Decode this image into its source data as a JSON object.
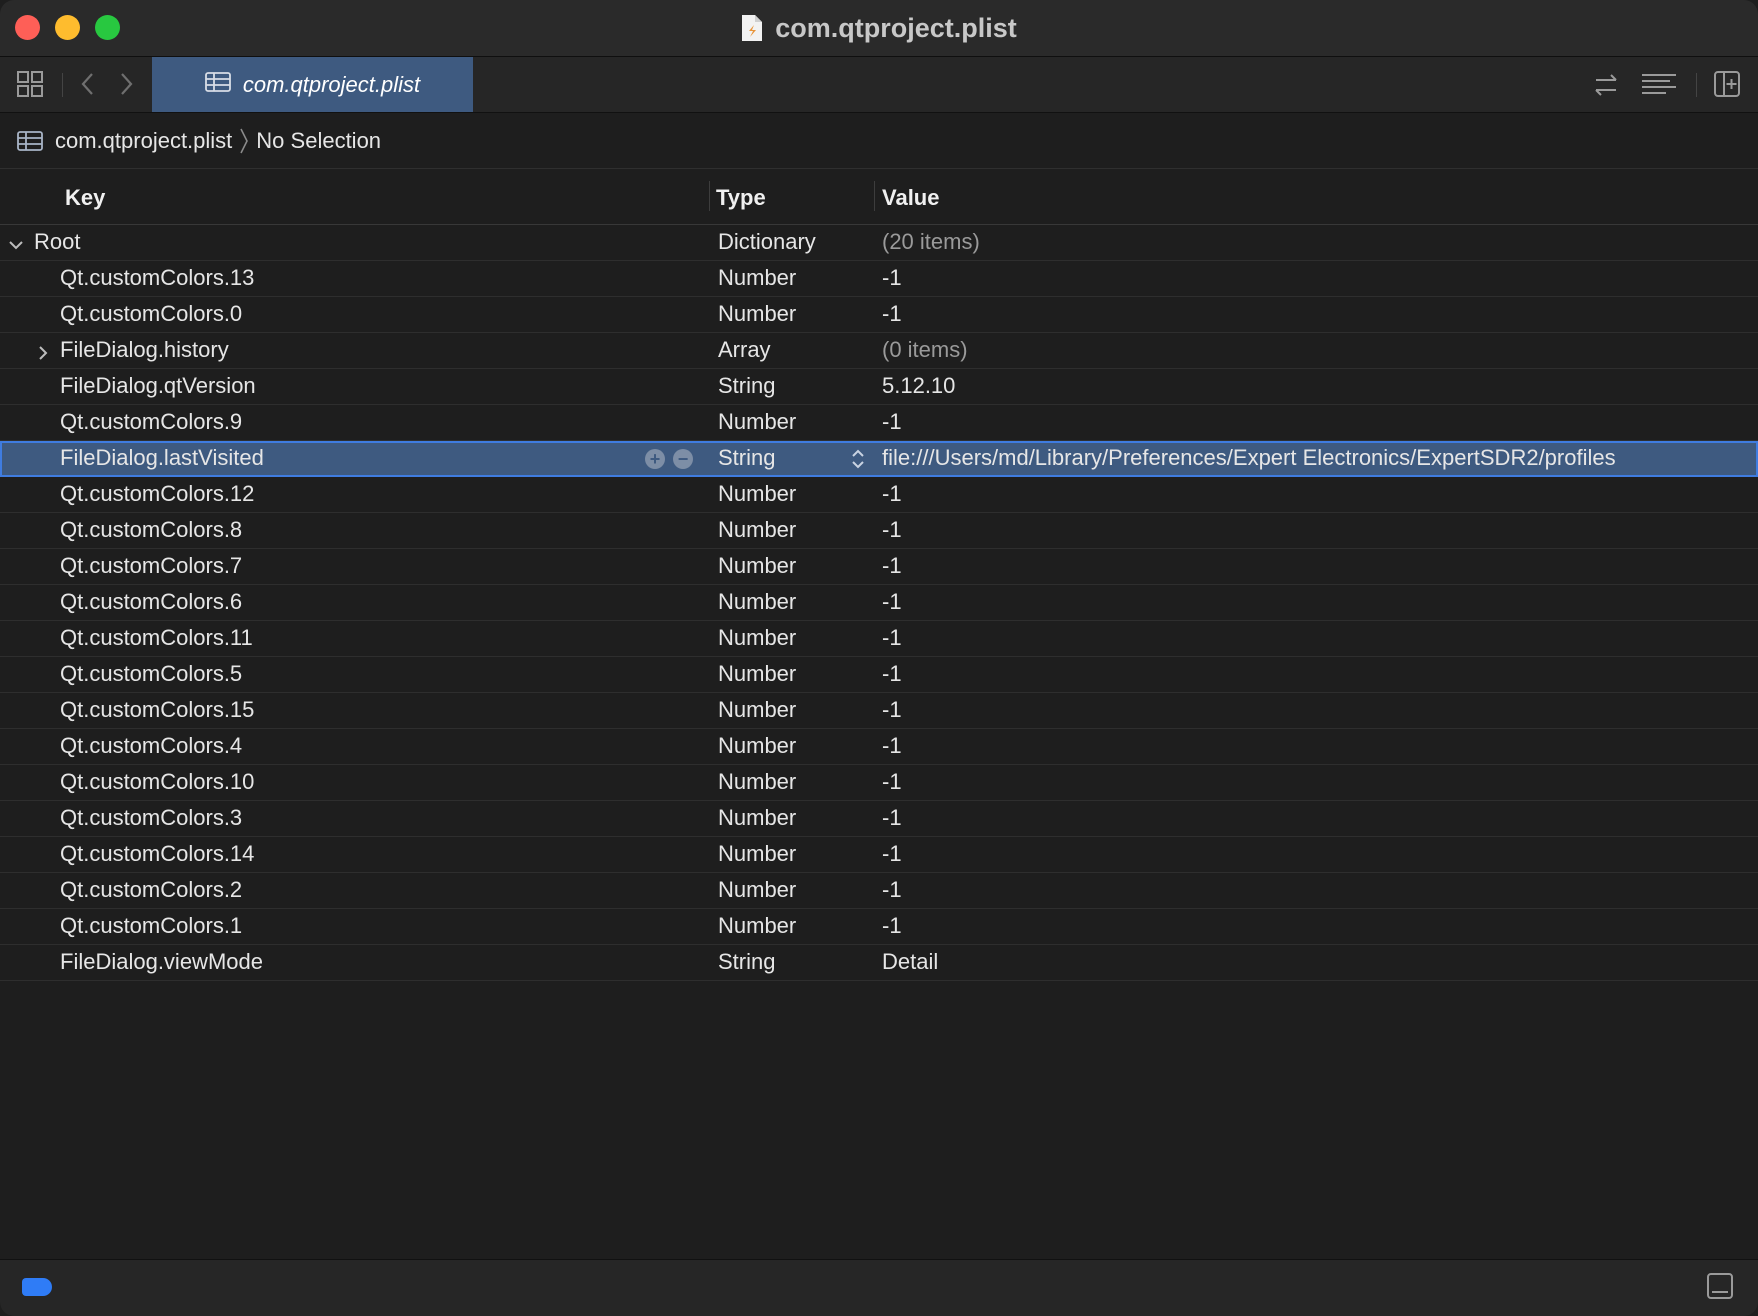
{
  "window": {
    "title": "com.qtproject.plist"
  },
  "toolbar": {
    "tab_label": "com.qtproject.plist"
  },
  "breadcrumb": {
    "file": "com.qtproject.plist",
    "selection": "No Selection"
  },
  "table": {
    "columns": {
      "key": "Key",
      "type": "Type",
      "value": "Value"
    },
    "root": {
      "key": "Root",
      "type": "Dictionary",
      "value": "(20 items)"
    },
    "rows": [
      {
        "key": "Qt.customColors.13",
        "type": "Number",
        "value": "-1"
      },
      {
        "key": "Qt.customColors.0",
        "type": "Number",
        "value": "-1"
      },
      {
        "key": "FileDialog.history",
        "type": "Array",
        "value": "(0 items)"
      },
      {
        "key": "FileDialog.qtVersion",
        "type": "String",
        "value": "5.12.10"
      },
      {
        "key": "Qt.customColors.9",
        "type": "Number",
        "value": "-1"
      },
      {
        "key": "FileDialog.lastVisited",
        "type": "String",
        "value": "file:///Users/md/Library/Preferences/Expert Electronics/ExpertSDR2/profiles"
      },
      {
        "key": "Qt.customColors.12",
        "type": "Number",
        "value": "-1"
      },
      {
        "key": "Qt.customColors.8",
        "type": "Number",
        "value": "-1"
      },
      {
        "key": "Qt.customColors.7",
        "type": "Number",
        "value": "-1"
      },
      {
        "key": "Qt.customColors.6",
        "type": "Number",
        "value": "-1"
      },
      {
        "key": "Qt.customColors.11",
        "type": "Number",
        "value": "-1"
      },
      {
        "key": "Qt.customColors.5",
        "type": "Number",
        "value": "-1"
      },
      {
        "key": "Qt.customColors.15",
        "type": "Number",
        "value": "-1"
      },
      {
        "key": "Qt.customColors.4",
        "type": "Number",
        "value": "-1"
      },
      {
        "key": "Qt.customColors.10",
        "type": "Number",
        "value": "-1"
      },
      {
        "key": "Qt.customColors.3",
        "type": "Number",
        "value": "-1"
      },
      {
        "key": "Qt.customColors.14",
        "type": "Number",
        "value": "-1"
      },
      {
        "key": "Qt.customColors.2",
        "type": "Number",
        "value": "-1"
      },
      {
        "key": "Qt.customColors.1",
        "type": "Number",
        "value": "-1"
      },
      {
        "key": "FileDialog.viewMode",
        "type": "String",
        "value": "Detail"
      }
    ]
  },
  "colors": {
    "selection": "#3e5a80",
    "selection_outline": "#3f7ce0",
    "tag_blue": "#2f7cf6"
  },
  "icons": [
    "grid-icon",
    "back-chevron-icon",
    "forward-chevron-icon",
    "table-icon",
    "swap-arrows-icon",
    "lines-icon",
    "add-panel-icon",
    "file-icon",
    "disclosure-icon",
    "add-icon",
    "remove-icon",
    "stepper-icon",
    "panel-toggle-icon",
    "tag-icon"
  ]
}
